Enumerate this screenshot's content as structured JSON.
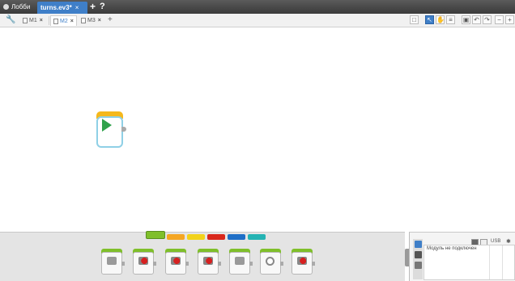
{
  "project_tabs": {
    "lobby_label": "Лобби",
    "active_file": "turns.ev3*",
    "close_glyph": "×",
    "add_glyph": "+",
    "help_glyph": "?"
  },
  "program_tabs": [
    {
      "label": "M1",
      "close": "×"
    },
    {
      "label": "M2",
      "close": "×"
    },
    {
      "label": "M3",
      "close": "×"
    }
  ],
  "program_tabs_add": "+",
  "toolbar": {
    "icons": [
      "content-editor-icon",
      "select-pointer-icon",
      "pan-hand-icon",
      "comment-icon",
      "save-icon",
      "undo-icon",
      "redo-icon",
      "zoom-out-icon",
      "zoom-in-icon"
    ]
  },
  "palette": {
    "categories": [
      {
        "name": "action",
        "color": "#7fbf2a"
      },
      {
        "name": "flow",
        "color": "#f5a623"
      },
      {
        "name": "sensor",
        "color": "#f2d21b"
      },
      {
        "name": "data",
        "color": "#d9281c"
      },
      {
        "name": "advanced",
        "color": "#1f6fc7"
      },
      {
        "name": "myblocks",
        "color": "#24b3b3"
      }
    ]
  },
  "hardware": {
    "status_text": "Модуль не подключен",
    "usb_label": "USB"
  },
  "colors": {
    "accent": "#3f7fc8",
    "start_block": "#31a24c"
  }
}
